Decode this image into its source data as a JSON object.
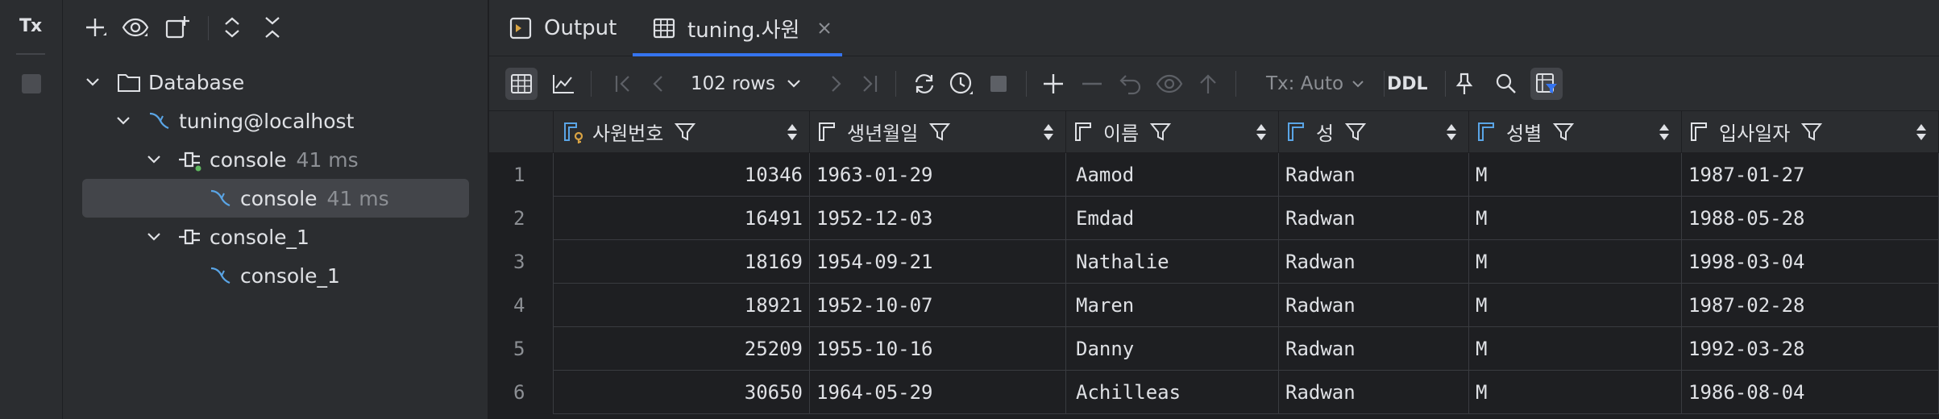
{
  "left_stripe": {
    "tx_label": "Tx"
  },
  "tree": {
    "items": [
      {
        "label": "Database",
        "meta": ""
      },
      {
        "label": "tuning@localhost",
        "meta": ""
      },
      {
        "label": "console",
        "meta": "41 ms"
      },
      {
        "label": "console",
        "meta": "41 ms"
      },
      {
        "label": "console_1",
        "meta": ""
      },
      {
        "label": "console_1",
        "meta": ""
      }
    ]
  },
  "tabs": [
    {
      "label": "Output"
    },
    {
      "label": "tuning.사원"
    }
  ],
  "toolbar": {
    "rows_label": "102 rows",
    "tx_mode": "Tx: Auto",
    "ddl_label": "DDL"
  },
  "table": {
    "columns": [
      "사원번호",
      "생년월일",
      "이름",
      "성",
      "성별",
      "입사일자"
    ],
    "rows": [
      [
        "1",
        "10346",
        "1963-01-29",
        "Aamod",
        "Radwan",
        "M",
        "1987-01-27"
      ],
      [
        "2",
        "16491",
        "1952-12-03",
        "Emdad",
        "Radwan",
        "M",
        "1988-05-28"
      ],
      [
        "3",
        "18169",
        "1954-09-21",
        "Nathalie",
        "Radwan",
        "M",
        "1998-03-04"
      ],
      [
        "4",
        "18921",
        "1952-10-07",
        "Maren",
        "Radwan",
        "M",
        "1987-02-28"
      ],
      [
        "5",
        "25209",
        "1955-10-16",
        "Danny",
        "Radwan",
        "M",
        "1992-03-28"
      ],
      [
        "6",
        "30650",
        "1964-05-29",
        "Achilleas",
        "Radwan",
        "M",
        "1986-08-04"
      ]
    ]
  },
  "colors": {
    "accent": "#3574f0",
    "background": "#1e1f22",
    "panel": "#2b2d30",
    "key_icon": "#d9a343"
  }
}
